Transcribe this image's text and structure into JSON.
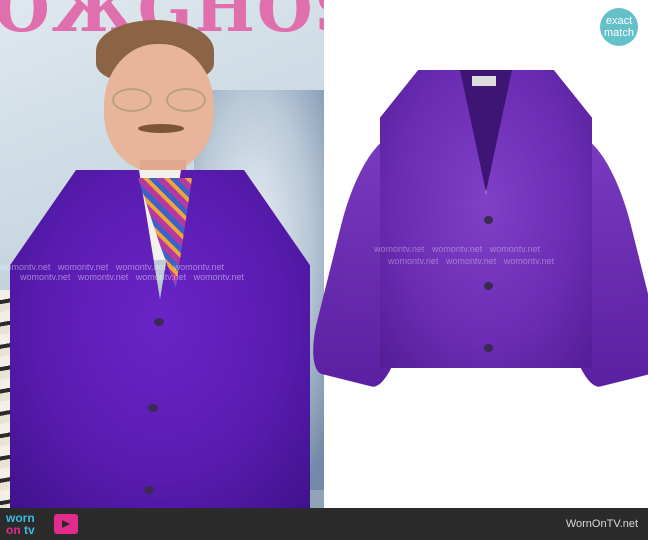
{
  "badge": {
    "line1": "exact",
    "line2": "match"
  },
  "watermark": "womontv.net",
  "footer": {
    "logo_word": "worn",
    "logo_on": "on",
    "logo_tv": "tv",
    "site": "WornOnTV.net"
  },
  "colors": {
    "accent": "#e22b8a",
    "badge": "#64c0c9",
    "cardigan": "#6a2cb3"
  }
}
